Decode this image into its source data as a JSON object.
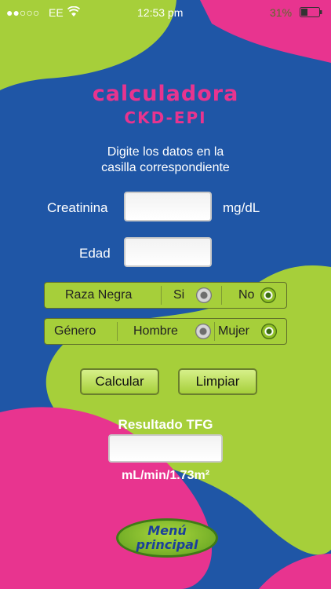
{
  "status_bar": {
    "carrier": "EE",
    "time": "12:53 pm",
    "battery": "31%"
  },
  "header": {
    "title": "calculadora",
    "subtitle": "CKD-EPI"
  },
  "instructions": {
    "line1": "Digite los datos en la",
    "line2": "casilla correspondiente"
  },
  "form": {
    "creatinina_label": "Creatinina",
    "creatinina_unit": "mg/dL",
    "creatinina_value": "",
    "edad_label": "Edad",
    "edad_value": ""
  },
  "raza": {
    "label": "Raza Negra",
    "option_si": "Si",
    "option_no": "No",
    "selected": "No"
  },
  "genero": {
    "label": "Género",
    "option_hombre": "Hombre",
    "option_mujer": "Mujer",
    "selected": "Mujer"
  },
  "buttons": {
    "calcular": "Calcular",
    "limpiar": "Limpiar"
  },
  "result": {
    "title": "Resultado TFG",
    "value": "",
    "units": "mL/min/1.73m²"
  },
  "menu": {
    "line1": "Menú",
    "line2": "principal"
  },
  "colors": {
    "background_blue": "#1f56a6",
    "green": "#a6cf3a",
    "pink": "#e8348f"
  }
}
